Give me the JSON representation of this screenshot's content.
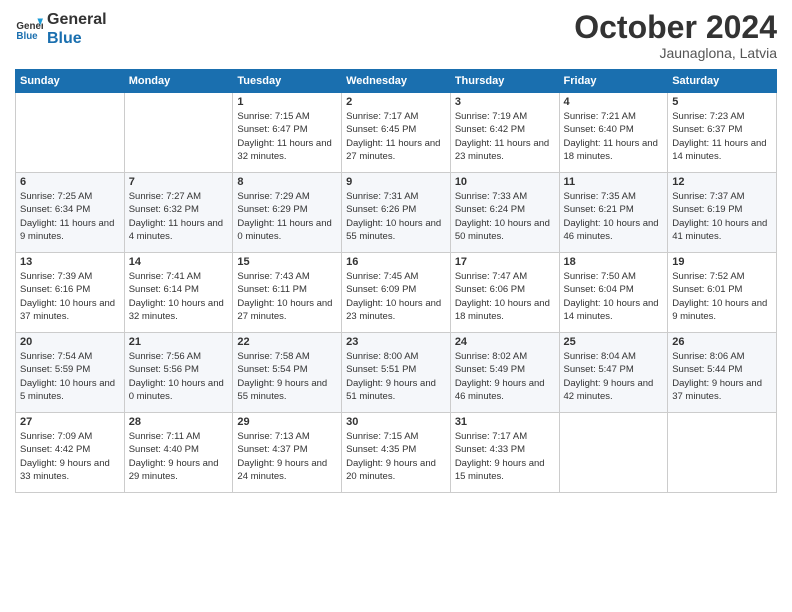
{
  "logo": {
    "line1": "General",
    "line2": "Blue"
  },
  "title": "October 2024",
  "location": "Jaunaglona, Latvia",
  "weekdays": [
    "Sunday",
    "Monday",
    "Tuesday",
    "Wednesday",
    "Thursday",
    "Friday",
    "Saturday"
  ],
  "weeks": [
    [
      {
        "day": "",
        "info": ""
      },
      {
        "day": "",
        "info": ""
      },
      {
        "day": "1",
        "info": "Sunrise: 7:15 AM\nSunset: 6:47 PM\nDaylight: 11 hours and 32 minutes."
      },
      {
        "day": "2",
        "info": "Sunrise: 7:17 AM\nSunset: 6:45 PM\nDaylight: 11 hours and 27 minutes."
      },
      {
        "day": "3",
        "info": "Sunrise: 7:19 AM\nSunset: 6:42 PM\nDaylight: 11 hours and 23 minutes."
      },
      {
        "day": "4",
        "info": "Sunrise: 7:21 AM\nSunset: 6:40 PM\nDaylight: 11 hours and 18 minutes."
      },
      {
        "day": "5",
        "info": "Sunrise: 7:23 AM\nSunset: 6:37 PM\nDaylight: 11 hours and 14 minutes."
      }
    ],
    [
      {
        "day": "6",
        "info": "Sunrise: 7:25 AM\nSunset: 6:34 PM\nDaylight: 11 hours and 9 minutes."
      },
      {
        "day": "7",
        "info": "Sunrise: 7:27 AM\nSunset: 6:32 PM\nDaylight: 11 hours and 4 minutes."
      },
      {
        "day": "8",
        "info": "Sunrise: 7:29 AM\nSunset: 6:29 PM\nDaylight: 11 hours and 0 minutes."
      },
      {
        "day": "9",
        "info": "Sunrise: 7:31 AM\nSunset: 6:26 PM\nDaylight: 10 hours and 55 minutes."
      },
      {
        "day": "10",
        "info": "Sunrise: 7:33 AM\nSunset: 6:24 PM\nDaylight: 10 hours and 50 minutes."
      },
      {
        "day": "11",
        "info": "Sunrise: 7:35 AM\nSunset: 6:21 PM\nDaylight: 10 hours and 46 minutes."
      },
      {
        "day": "12",
        "info": "Sunrise: 7:37 AM\nSunset: 6:19 PM\nDaylight: 10 hours and 41 minutes."
      }
    ],
    [
      {
        "day": "13",
        "info": "Sunrise: 7:39 AM\nSunset: 6:16 PM\nDaylight: 10 hours and 37 minutes."
      },
      {
        "day": "14",
        "info": "Sunrise: 7:41 AM\nSunset: 6:14 PM\nDaylight: 10 hours and 32 minutes."
      },
      {
        "day": "15",
        "info": "Sunrise: 7:43 AM\nSunset: 6:11 PM\nDaylight: 10 hours and 27 minutes."
      },
      {
        "day": "16",
        "info": "Sunrise: 7:45 AM\nSunset: 6:09 PM\nDaylight: 10 hours and 23 minutes."
      },
      {
        "day": "17",
        "info": "Sunrise: 7:47 AM\nSunset: 6:06 PM\nDaylight: 10 hours and 18 minutes."
      },
      {
        "day": "18",
        "info": "Sunrise: 7:50 AM\nSunset: 6:04 PM\nDaylight: 10 hours and 14 minutes."
      },
      {
        "day": "19",
        "info": "Sunrise: 7:52 AM\nSunset: 6:01 PM\nDaylight: 10 hours and 9 minutes."
      }
    ],
    [
      {
        "day": "20",
        "info": "Sunrise: 7:54 AM\nSunset: 5:59 PM\nDaylight: 10 hours and 5 minutes."
      },
      {
        "day": "21",
        "info": "Sunrise: 7:56 AM\nSunset: 5:56 PM\nDaylight: 10 hours and 0 minutes."
      },
      {
        "day": "22",
        "info": "Sunrise: 7:58 AM\nSunset: 5:54 PM\nDaylight: 9 hours and 55 minutes."
      },
      {
        "day": "23",
        "info": "Sunrise: 8:00 AM\nSunset: 5:51 PM\nDaylight: 9 hours and 51 minutes."
      },
      {
        "day": "24",
        "info": "Sunrise: 8:02 AM\nSunset: 5:49 PM\nDaylight: 9 hours and 46 minutes."
      },
      {
        "day": "25",
        "info": "Sunrise: 8:04 AM\nSunset: 5:47 PM\nDaylight: 9 hours and 42 minutes."
      },
      {
        "day": "26",
        "info": "Sunrise: 8:06 AM\nSunset: 5:44 PM\nDaylight: 9 hours and 37 minutes."
      }
    ],
    [
      {
        "day": "27",
        "info": "Sunrise: 7:09 AM\nSunset: 4:42 PM\nDaylight: 9 hours and 33 minutes."
      },
      {
        "day": "28",
        "info": "Sunrise: 7:11 AM\nSunset: 4:40 PM\nDaylight: 9 hours and 29 minutes."
      },
      {
        "day": "29",
        "info": "Sunrise: 7:13 AM\nSunset: 4:37 PM\nDaylight: 9 hours and 24 minutes."
      },
      {
        "day": "30",
        "info": "Sunrise: 7:15 AM\nSunset: 4:35 PM\nDaylight: 9 hours and 20 minutes."
      },
      {
        "day": "31",
        "info": "Sunrise: 7:17 AM\nSunset: 4:33 PM\nDaylight: 9 hours and 15 minutes."
      },
      {
        "day": "",
        "info": ""
      },
      {
        "day": "",
        "info": ""
      }
    ]
  ]
}
